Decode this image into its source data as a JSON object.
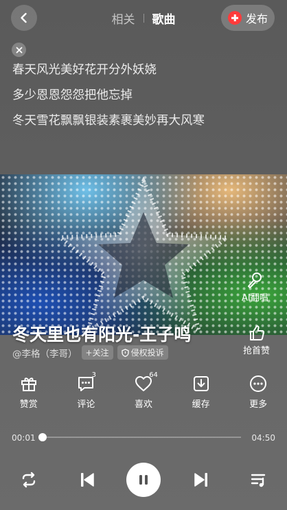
{
  "header": {
    "tabs": [
      {
        "label": "相关",
        "active": false
      },
      {
        "label": "歌曲",
        "active": true
      }
    ],
    "publish_label": "发布",
    "publish_icon": "plus-circle-icon",
    "back_icon": "chevron-left-icon"
  },
  "lyrics": {
    "close_icon": "close-icon",
    "lines": [
      "春天风光美好花开分外妖娆",
      "多少恩恩怨怨把他忘掉",
      "冬天雪花飘飘银装素裹美妙再大风寒"
    ]
  },
  "song": {
    "title": "冬天里也有阳光-王子鸣",
    "artist": "@李格（李哥）",
    "follow_label": "+关注",
    "report_label": "侵权投诉"
  },
  "side_actions": {
    "ai_sing": "AI翻唱",
    "first_like": "抢首赞"
  },
  "actions": [
    {
      "label": "赞赏",
      "icon": "gift-icon",
      "count": ""
    },
    {
      "label": "评论",
      "icon": "comment-icon",
      "count": "3"
    },
    {
      "label": "喜欢",
      "icon": "heart-icon",
      "count": "64"
    },
    {
      "label": "缓存",
      "icon": "download-icon",
      "count": ""
    },
    {
      "label": "更多",
      "icon": "more-icon",
      "count": ""
    }
  ],
  "player": {
    "current_time": "00:01",
    "duration": "04:50",
    "progress": 0.0035,
    "controls": [
      "repeat-icon",
      "previous-icon",
      "pause-icon",
      "next-icon",
      "playlist-icon"
    ]
  },
  "colors": {
    "accent_red": "#ff3b3b",
    "background": "#5f5f5f"
  }
}
